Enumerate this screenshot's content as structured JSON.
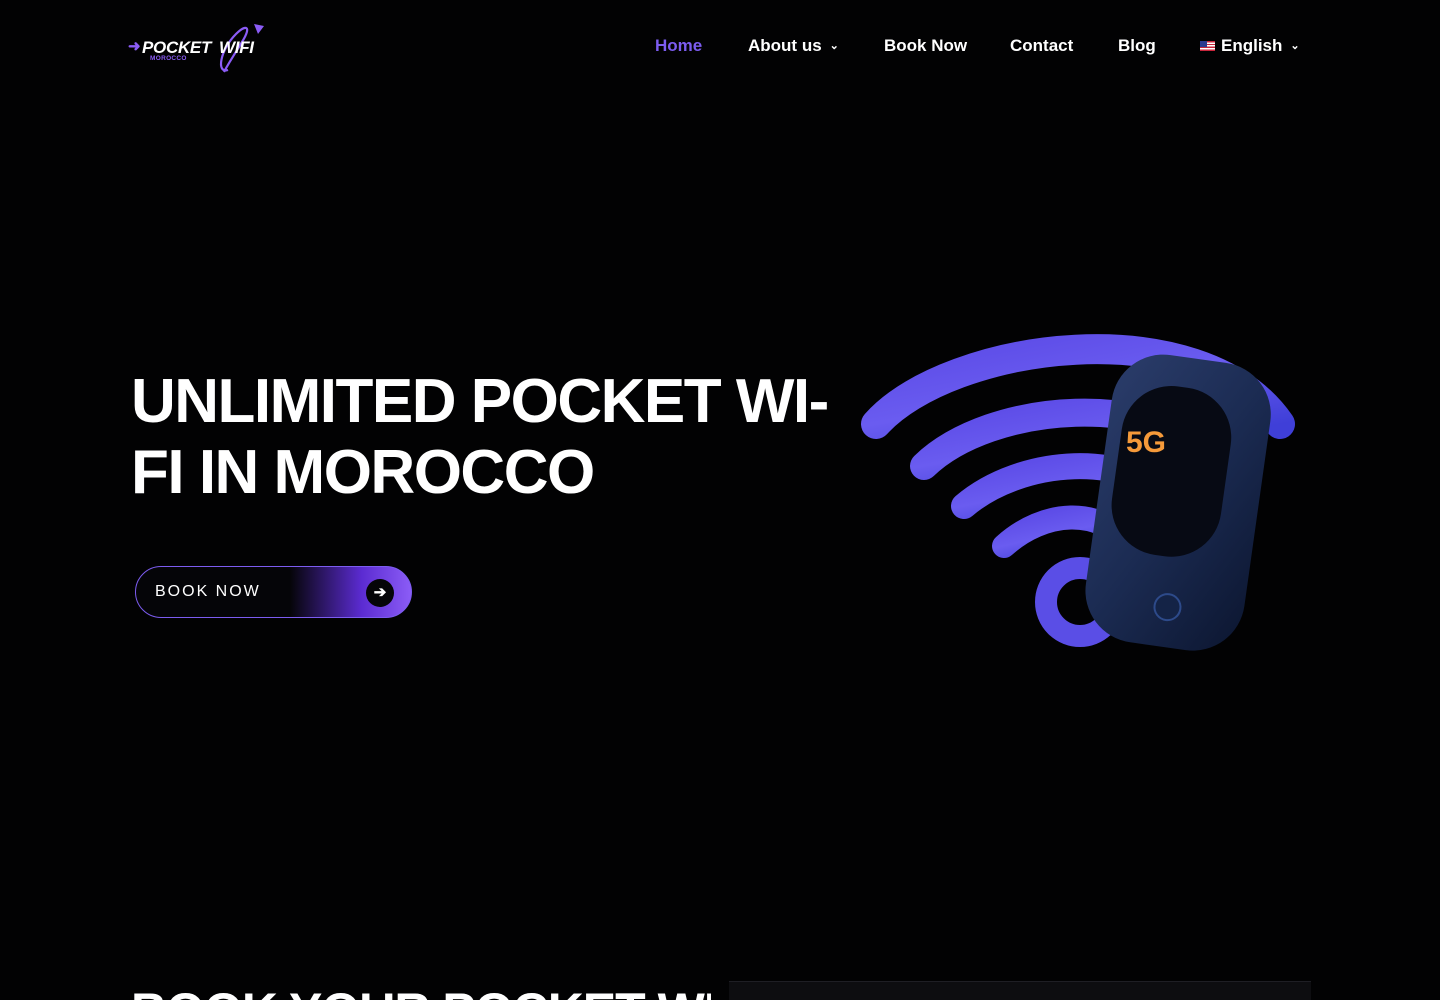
{
  "brand": {
    "logo_main_1": "POCKET",
    "logo_main_2": "WIFI",
    "logo_sub": "MOROCCO",
    "accent": "#7c5cf0"
  },
  "nav": {
    "home": "Home",
    "about": "About us",
    "book": "Book Now",
    "contact": "Contact",
    "blog": "Blog",
    "language": "English"
  },
  "hero": {
    "title_line1": "UNLIMITED POCKET WI-",
    "title_line2": "FI IN MOROCCO",
    "button_label": "BOOK NOW",
    "device_badge": "5G"
  },
  "section2": {
    "title": "BOOK YOUR POCKET WI"
  }
}
